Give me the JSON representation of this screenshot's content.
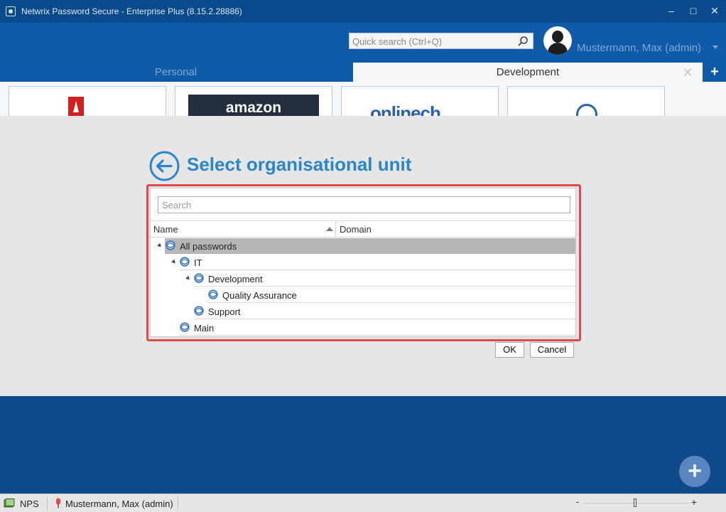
{
  "window": {
    "title": "Netwrix Password Secure - Enterprise Plus (8.15.2.28886)",
    "minimize": "–",
    "maximize": "□",
    "close": "✕"
  },
  "header": {
    "search_placeholder": "Quick search (Ctrl+Q)",
    "user_name": "Mustermann, Max (admin)"
  },
  "tabs": {
    "items": [
      {
        "label": "Personal",
        "active": false
      },
      {
        "label": "Development",
        "active": true
      }
    ],
    "close_glyph": "✕",
    "add_glyph": "+"
  },
  "tiles": {
    "amazon_text": "amazon",
    "onlinech_text": "onlinech",
    "onlinech_tld": ""
  },
  "dialog": {
    "title": "Select organisational unit",
    "search_placeholder": "Search",
    "columns": {
      "name": "Name",
      "domain": "Domain"
    },
    "tree": [
      {
        "label": "All passwords",
        "domain": "",
        "depth": 0,
        "expanded": true,
        "selected": true
      },
      {
        "label": "IT",
        "domain": "",
        "depth": 1,
        "expanded": true,
        "selected": false
      },
      {
        "label": "Development",
        "domain": "",
        "depth": 2,
        "expanded": true,
        "selected": false
      },
      {
        "label": "Quality Assurance",
        "domain": "",
        "depth": 3,
        "expanded": false,
        "selected": false
      },
      {
        "label": "Support",
        "domain": "",
        "depth": 2,
        "expanded": false,
        "selected": false
      },
      {
        "label": "Main",
        "domain": "",
        "depth": 1,
        "expanded": false,
        "selected": false
      }
    ],
    "ok_label": "OK",
    "cancel_label": "Cancel"
  },
  "fab": {
    "glyph": "+"
  },
  "statusbar": {
    "app": "NPS",
    "user": "Mustermann, Max (admin)",
    "zoom_minus": "-",
    "zoom_plus": "+"
  },
  "colors": {
    "header_blue": "#0f5ba9",
    "accent_blue": "#2b86c9",
    "highlight_red": "#e04a4a",
    "selected_row": "#b7b7b7"
  }
}
